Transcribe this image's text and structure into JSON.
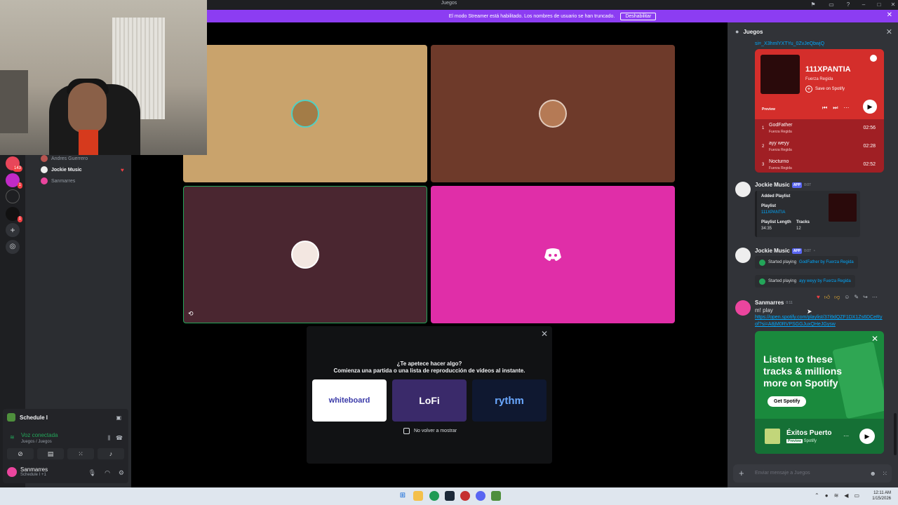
{
  "window": {
    "title": "Juegos"
  },
  "banner": {
    "text": "El modo Streamer está habilitado. Los nombres de usuario se han truncado.",
    "button": "Deshabilitar"
  },
  "rail": {
    "badges": [
      "143",
      "1",
      "1"
    ]
  },
  "members": [
    {
      "name": "Andres Guerrero",
      "active": false
    },
    {
      "name": "Jockie Music",
      "active": true
    },
    {
      "name": "Sanmarres",
      "active": false
    }
  ],
  "bottom_panel": {
    "game": "Schedule I",
    "voice_status": "Voz conectada",
    "voice_channel": "Juegos / Juegos",
    "user_name": "Sanmarres",
    "user_status": "Schedule I +1"
  },
  "activity": {
    "question": "¿Te apetece hacer algo?",
    "subtitle": "Comienza una partida o una lista de reproducción de vídeos al instante.",
    "cards": [
      "whiteboard",
      "LoFi",
      "rythm"
    ],
    "checkbox": "No volver a mostrar"
  },
  "chat": {
    "title": "Juegos",
    "top_link": "si=_X3hmlYXTYu_0ZvJeQbwjQ",
    "spotify": {
      "title": "111XPANTIA",
      "artist": "Fuerza Regida",
      "save": "Save on Spotify",
      "preview": "Preview",
      "tracks": [
        {
          "num": "1",
          "name": "GodFather",
          "artist": "Fuerza Regida",
          "duration": "02:56"
        },
        {
          "num": "2",
          "name": "ayy weyy",
          "artist": "Fuerza Regida",
          "duration": "02:28"
        },
        {
          "num": "3",
          "name": "Nocturno",
          "artist": "Fuerza Regida",
          "duration": "02:52"
        }
      ]
    },
    "msg1": {
      "author": "Jockie Music",
      "badge": "APP",
      "time": "0:07",
      "embed_title": "Added Playlist",
      "playlist_label": "Playlist",
      "playlist_value": "111XPANTIA",
      "length_label": "Playlist Length",
      "length_value": "34:35",
      "tracks_label": "Tracks",
      "tracks_value": "12"
    },
    "msg2": {
      "author": "Jockie Music",
      "badge": "APP",
      "time": "0:07",
      "line1_prefix": "Started playing",
      "line1_track": "GodFather by Fuerza Regida",
      "line2_prefix": "Started playing",
      "line2_track": "ayy weyy by Fuerza Regida"
    },
    "msg3": {
      "author": "Sanmarres",
      "time": "0:11",
      "text": "m! play",
      "link": "https://open.spotify.com/playlist/37i9dQZF1DX1Zs6DCeRyof?si=A8jM0RVPSGGJuxQHeJGysw"
    },
    "promo": {
      "headline": "Listen to these tracks & millions more on Spotify",
      "button": "Get Spotify",
      "playlist": "Éxitos Puerto",
      "preview": "Preview",
      "source": "Spotify"
    },
    "composer_placeholder": "Enviar mensaje a Juegos"
  },
  "taskbar": {
    "time": "12:11 AM",
    "date": "1/15/2026"
  },
  "colors": {
    "accent": "#8c3df2",
    "blurple": "#5865f2",
    "spotify_red": "#d42e2b",
    "spotify_green": "#1a8a3d",
    "pink_tile": "#e02ea8"
  }
}
